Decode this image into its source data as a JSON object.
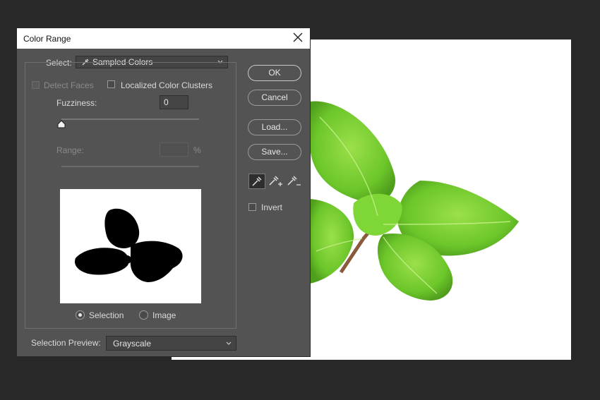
{
  "dialog": {
    "title": "Color Range",
    "select_label": "Select:",
    "select_value": "Sampled Colors",
    "detect_faces_label": "Detect Faces",
    "localized_clusters_label": "Localized Color Clusters",
    "fuzziness_label": "Fuzziness:",
    "fuzziness_value": "0",
    "fuzziness_slider_fraction": 0,
    "range_label": "Range:",
    "range_value": "",
    "range_unit": "%",
    "preview_mode_selection": "Selection",
    "preview_mode_image": "Image",
    "preview_mode_selected": "Selection",
    "selection_preview_label": "Selection Preview:",
    "selection_preview_value": "Grayscale",
    "buttons": {
      "ok": "OK",
      "cancel": "Cancel",
      "load": "Load...",
      "save": "Save..."
    },
    "tools": [
      "eyedropper-icon",
      "eyedropper-plus-icon",
      "eyedropper-minus-icon"
    ],
    "invert_label": "Invert"
  },
  "colors": {
    "workspace_bg": "#282828",
    "dialog_bg": "#535353",
    "leaf_green": "#6cc62a"
  }
}
